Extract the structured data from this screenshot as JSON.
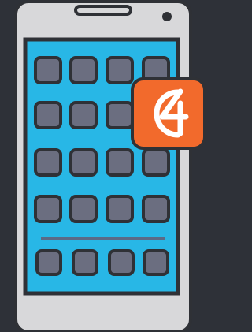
{
  "illustration": {
    "subject": "smartphone-home-screen-with-app-badge",
    "colors": {
      "background": "#2e3138",
      "phone_body": "#d8d8da",
      "phone_outline": "#2f3136",
      "screen": "#28b7e6",
      "app_tile": "#6b6e80",
      "divider": "#5b6a86",
      "badge": "#f26a2c",
      "badge_outline": "#2f3136",
      "badge_glyph": "#ffffff"
    },
    "grid": {
      "rows": 4,
      "cols": 4
    },
    "dock": {
      "count": 4
    },
    "badge": {
      "glyph": "4"
    }
  }
}
